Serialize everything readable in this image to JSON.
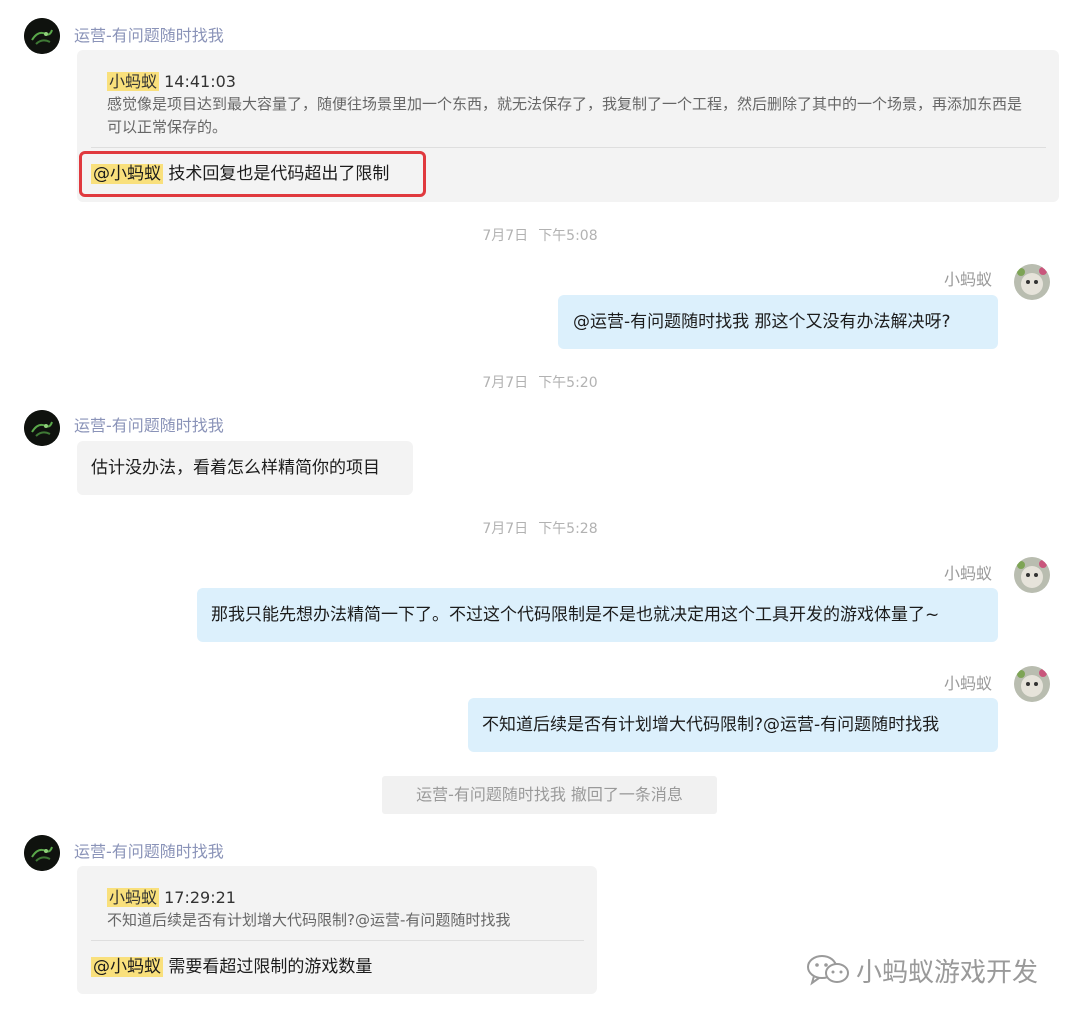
{
  "users": {
    "operator": "运营-有问题随时找我",
    "me": "小蚂蚁"
  },
  "messages": {
    "m1": {
      "quote_author": "小蚂蚁",
      "quote_time": "14:41:03",
      "quote_text": "感觉像是项目达到最大容量了，随便往场景里加一个东西，就无法保存了，我复制了一个工程，然后删除了其中的一个场景，再添加东西是可以正常保存的。",
      "mention": "@小蚂蚁",
      "reply": "技术回复也是代码超出了限制"
    },
    "ts1": {
      "date": "7月7日",
      "time": "下午5:08"
    },
    "m2": {
      "text": "@运营-有问题随时找我 那这个又没有办法解决呀?"
    },
    "ts2": {
      "date": "7月7日",
      "time": "下午5:20"
    },
    "m3": {
      "text": "估计没办法，看着怎么样精简你的项目"
    },
    "ts3": {
      "date": "7月7日",
      "time": "下午5:28"
    },
    "m4": {
      "text": "那我只能先想办法精简一下了。不过这个代码限制是不是也就决定用这个工具开发的游戏体量了~"
    },
    "m5": {
      "text": "不知道后续是否有计划增大代码限制?@运营-有问题随时找我"
    },
    "recall": "运营-有问题随时找我 撤回了一条消息",
    "m6": {
      "quote_author": "小蚂蚁",
      "quote_time": "17:29:21",
      "quote_text": "不知道后续是否有计划增大代码限制?@运营-有问题随时找我",
      "mention": "@小蚂蚁",
      "reply": "需要看超过限制的游戏数量"
    }
  },
  "watermark": {
    "text": "小蚂蚁游戏开发",
    "icon": "wechat-icon"
  },
  "colors": {
    "incoming_bubble": "#f3f3f3",
    "outgoing_bubble": "#dcf0fc",
    "mention_highlight": "#f9e07c",
    "annotation_box": "#e0393e"
  }
}
